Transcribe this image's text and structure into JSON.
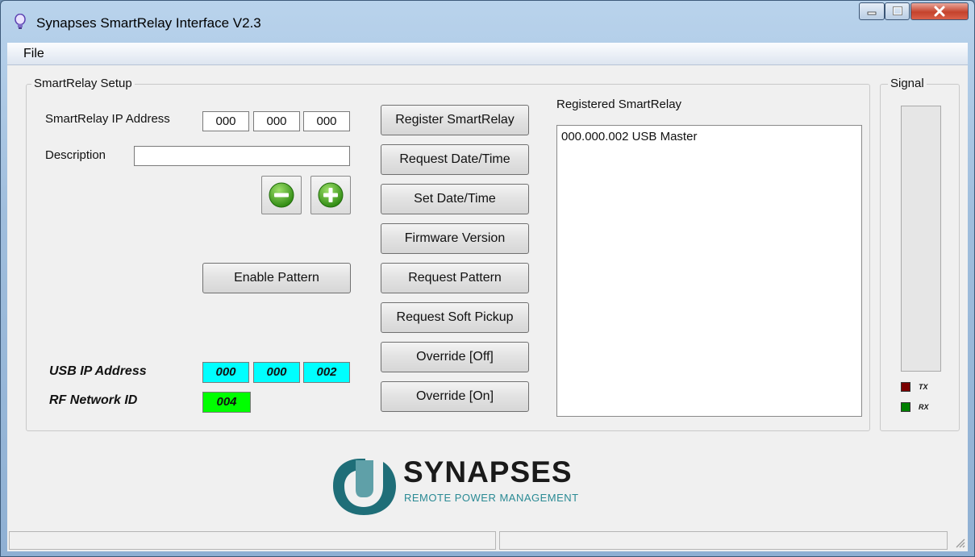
{
  "window": {
    "title": "Synapses SmartRelay Interface V2.3",
    "controls": {
      "minimize_icon": "minimize-icon",
      "maximize_icon": "maximize-icon",
      "close_icon": "close-icon"
    }
  },
  "menu": {
    "items": [
      {
        "label": "File"
      }
    ]
  },
  "setup": {
    "group_title": "SmartRelay Setup",
    "ip_label": "SmartRelay IP Address",
    "ip_octets": [
      "000",
      "000",
      "000"
    ],
    "description_label": "Description",
    "description_value": "",
    "remove_icon": "minus-circle-icon",
    "add_icon": "plus-circle-icon",
    "enable_pattern_label": "Enable Pattern",
    "usb_ip_label": "USB IP Address",
    "usb_ip_octets": [
      "000",
      "000",
      "002"
    ],
    "rf_network_label": "RF Network ID",
    "rf_network_id": "004",
    "colors": {
      "usb_ip_bg": "#00ffff",
      "rf_network_bg": "#00ff00",
      "icon_green": "#3a9a1a"
    }
  },
  "actions": [
    {
      "label": "Register SmartRelay"
    },
    {
      "label": "Request Date/Time"
    },
    {
      "label": "Set Date/Time"
    },
    {
      "label": "Firmware Version"
    },
    {
      "label": "Request Pattern"
    },
    {
      "label": "Request Soft Pickup"
    },
    {
      "label": "Override [Off]"
    },
    {
      "label": "Override [On]"
    }
  ],
  "registered": {
    "title": "Registered SmartRelay",
    "items": [
      "000.000.002 USB Master"
    ]
  },
  "signal": {
    "group_title": "Signal",
    "tx_label": "TX",
    "rx_label": "RX",
    "tx_color": "#7a0000",
    "rx_color": "#008000"
  },
  "logo": {
    "name": "SYNAPSES",
    "tagline": "REMOTE POWER MANAGEMENT",
    "colors": {
      "mark": "#1f6e78",
      "text": "#1a1a1a",
      "tagline": "#2a8a94"
    }
  }
}
